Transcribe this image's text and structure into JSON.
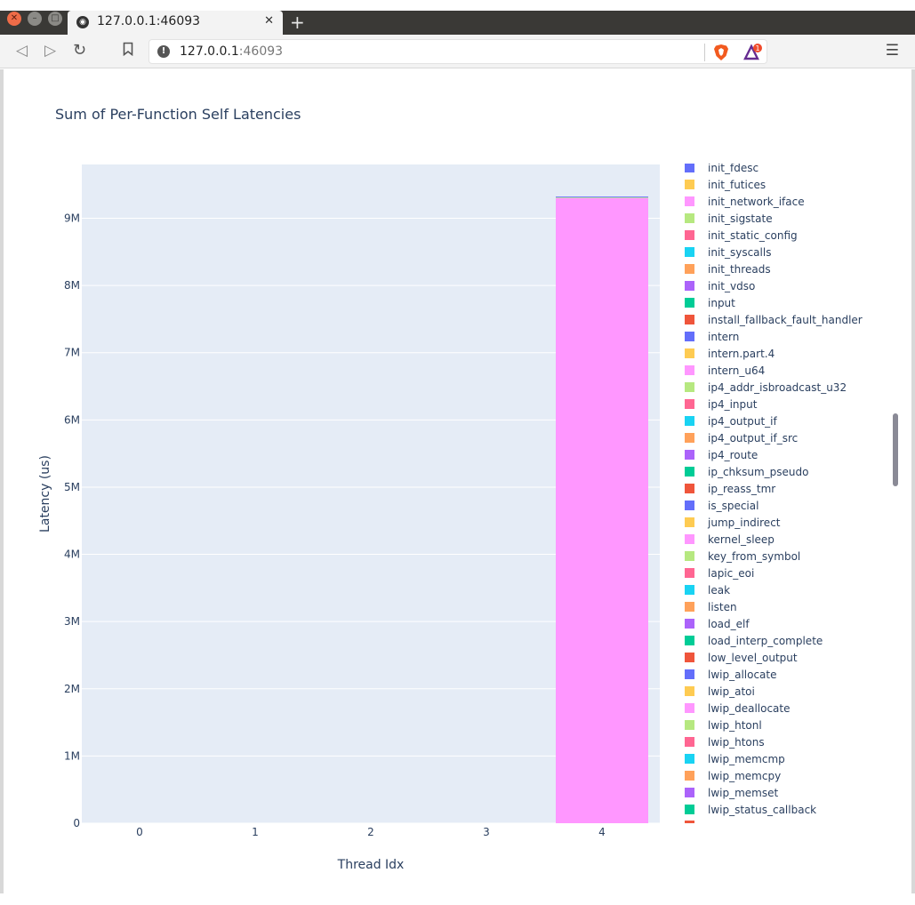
{
  "browser": {
    "tab_title": "127.0.0.1:46093",
    "url_host": "127.0.0.1",
    "url_port": ":46093",
    "rewards_badge": "1"
  },
  "chart_data": {
    "type": "bar",
    "barmode": "stack",
    "title": "Sum of Per-Function Self Latencies",
    "xlabel": "Thread Idx",
    "ylabel": "Latency (us)",
    "categories": [
      "0",
      "1",
      "2",
      "3",
      "4"
    ],
    "ylim": [
      0,
      9.8
    ],
    "yticks": [
      0,
      1,
      2,
      3,
      4,
      5,
      6,
      7,
      8,
      9
    ],
    "ytick_labels": [
      "0",
      "1M",
      "2M",
      "3M",
      "4M",
      "5M",
      "6M",
      "7M",
      "8M",
      "9M"
    ],
    "y_unit_note": "",
    "grid": true,
    "legend_position": "right",
    "series": [
      {
        "name": "intern_u64",
        "color": "#FF97FF",
        "values": [
          0,
          0,
          0,
          0,
          9.3
        ]
      },
      {
        "name": "ip4_addr_isbroadcast_u32",
        "color": "#B6E880",
        "values": [
          0,
          0,
          0,
          0,
          0.01
        ]
      },
      {
        "name": "intern",
        "color": "#636EFA",
        "values": [
          0,
          0,
          0,
          0,
          0.012
        ]
      }
    ],
    "legend": [
      {
        "name": "init_fdesc",
        "color": "#636EFA"
      },
      {
        "name": "init_futices",
        "color": "#FECB52"
      },
      {
        "name": "init_network_iface",
        "color": "#FF97FF"
      },
      {
        "name": "init_sigstate",
        "color": "#B6E880"
      },
      {
        "name": "init_static_config",
        "color": "#FF6692"
      },
      {
        "name": "init_syscalls",
        "color": "#19D3F3"
      },
      {
        "name": "init_threads",
        "color": "#FFA15A"
      },
      {
        "name": "init_vdso",
        "color": "#AB63FA"
      },
      {
        "name": "input",
        "color": "#00CC96"
      },
      {
        "name": "install_fallback_fault_handler",
        "color": "#EF553B"
      },
      {
        "name": "intern",
        "color": "#636EFA"
      },
      {
        "name": "intern.part.4",
        "color": "#FECB52"
      },
      {
        "name": "intern_u64",
        "color": "#FF97FF"
      },
      {
        "name": "ip4_addr_isbroadcast_u32",
        "color": "#B6E880"
      },
      {
        "name": "ip4_input",
        "color": "#FF6692"
      },
      {
        "name": "ip4_output_if",
        "color": "#19D3F3"
      },
      {
        "name": "ip4_output_if_src",
        "color": "#FFA15A"
      },
      {
        "name": "ip4_route",
        "color": "#AB63FA"
      },
      {
        "name": "ip_chksum_pseudo",
        "color": "#00CC96"
      },
      {
        "name": "ip_reass_tmr",
        "color": "#EF553B"
      },
      {
        "name": "is_special",
        "color": "#636EFA"
      },
      {
        "name": "jump_indirect",
        "color": "#FECB52"
      },
      {
        "name": "kernel_sleep",
        "color": "#FF97FF"
      },
      {
        "name": "key_from_symbol",
        "color": "#B6E880"
      },
      {
        "name": "lapic_eoi",
        "color": "#FF6692"
      },
      {
        "name": "leak",
        "color": "#19D3F3"
      },
      {
        "name": "listen",
        "color": "#FFA15A"
      },
      {
        "name": "load_elf",
        "color": "#AB63FA"
      },
      {
        "name": "load_interp_complete",
        "color": "#00CC96"
      },
      {
        "name": "low_level_output",
        "color": "#EF553B"
      },
      {
        "name": "lwip_allocate",
        "color": "#636EFA"
      },
      {
        "name": "lwip_atoi",
        "color": "#FECB52"
      },
      {
        "name": "lwip_deallocate",
        "color": "#FF97FF"
      },
      {
        "name": "lwip_htonl",
        "color": "#B6E880"
      },
      {
        "name": "lwip_htons",
        "color": "#FF6692"
      },
      {
        "name": "lwip_memcmp",
        "color": "#19D3F3"
      },
      {
        "name": "lwip_memcpy",
        "color": "#FFA15A"
      },
      {
        "name": "lwip_memset",
        "color": "#AB63FA"
      },
      {
        "name": "lwip_status_callback",
        "color": "#00CC96"
      }
    ]
  }
}
